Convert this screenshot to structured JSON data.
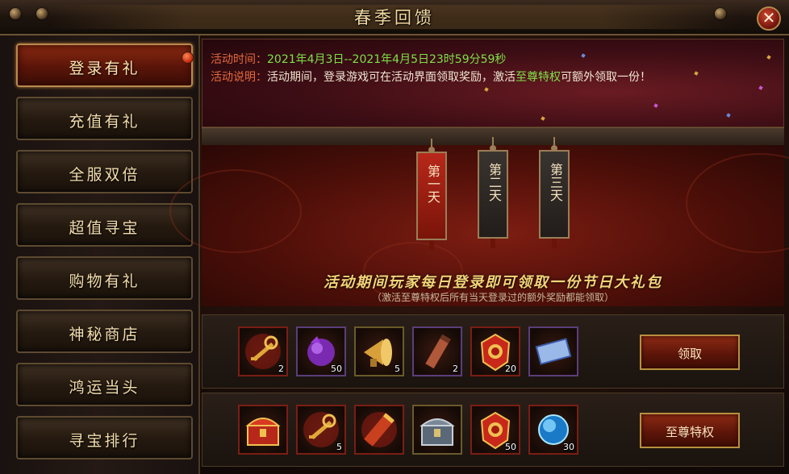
{
  "window": {
    "title": "春季回馈",
    "close_icon": "close-icon",
    "close_glyph": "✕"
  },
  "sidebar": {
    "items": [
      {
        "label": "登录有礼",
        "active": true,
        "notify": true
      },
      {
        "label": "充值有礼"
      },
      {
        "label": "全服双倍"
      },
      {
        "label": "超值寻宝"
      },
      {
        "label": "购物有礼"
      },
      {
        "label": "神秘商店"
      },
      {
        "label": "鸿运当头"
      },
      {
        "label": "寻宝排行"
      }
    ]
  },
  "info": {
    "time_label": "活动时间：",
    "time_value": "2021年4月3日--2021年4月5日23时59分59秒",
    "desc_label": "活动说明：",
    "desc_text_1": "活动期间，登录游戏可在活动界面领取奖励，激活",
    "desc_highlight": "至尊特权",
    "desc_text_2": "可额外领取一份！"
  },
  "days": [
    {
      "label": "第一天",
      "selected": true
    },
    {
      "label": "第二天"
    },
    {
      "label": "第三天"
    }
  ],
  "headline": "活动期间玩家每日登录即可领取一份节日大礼包",
  "subnote": "（激活至尊特权后所有当天登录过的额外奖励都能领取）",
  "rewards": {
    "row1": {
      "button_label": "领取",
      "items": [
        {
          "icon": "golden-key-icon",
          "count": "2"
        },
        {
          "icon": "purple-orb-icon",
          "count": "50"
        },
        {
          "icon": "horn-icon",
          "count": "5"
        },
        {
          "icon": "scroll-tube-icon",
          "count": "2"
        },
        {
          "icon": "red-token-icon",
          "count": "20"
        },
        {
          "icon": "blue-scroll-icon",
          "count": ""
        }
      ]
    },
    "row2": {
      "button_label": "至尊特权",
      "items": [
        {
          "icon": "treasure-chest-icon",
          "count": ""
        },
        {
          "icon": "golden-key-icon",
          "count": "5"
        },
        {
          "icon": "red-scroll-icon",
          "count": ""
        },
        {
          "icon": "silver-chest-icon",
          "count": ""
        },
        {
          "icon": "red-token-icon",
          "count": "50"
        },
        {
          "icon": "blue-orb-icon",
          "count": "30"
        }
      ]
    }
  },
  "colors": {
    "accent_gold": "#f7d47a",
    "highlight_green": "#7fe049",
    "label_orange": "#e46a3c",
    "button_red": "#8c2a14"
  }
}
